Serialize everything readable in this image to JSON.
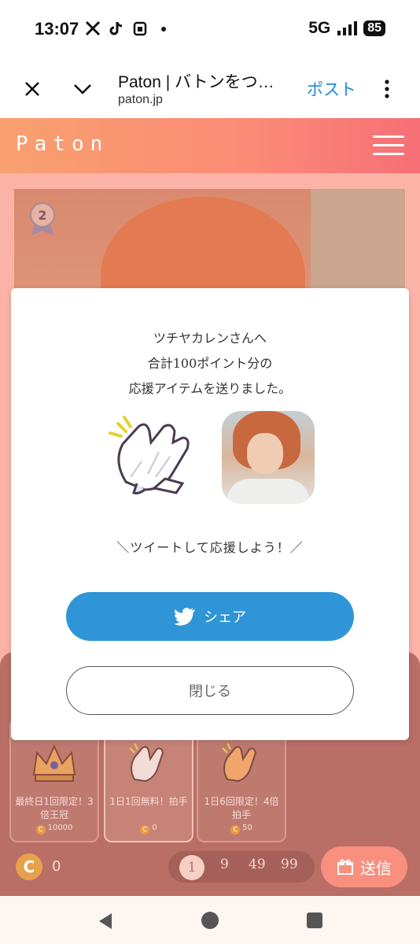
{
  "status_bar": {
    "time": "13:07",
    "network": "5G",
    "battery": "85"
  },
  "browser": {
    "title": "Paton | バトンをつ…",
    "url": "paton.jp",
    "post_label": "ポスト"
  },
  "site": {
    "logo": "Paton"
  },
  "rank": {
    "value": "2"
  },
  "modal": {
    "message_line1": "ツチヤカレンさんへ",
    "message_line2": "合計100ポイント分の",
    "message_line3": "応援アイテムを送りました。",
    "tweet_prompt": "＼ツイートして応援しよう！／",
    "share_label": "シェア",
    "close_label": "閉じる"
  },
  "gifts": [
    {
      "name": "最終日1回限定！3倍王冠",
      "cost": "10000",
      "icon": "crown-icon"
    },
    {
      "name": "1日1回無料！拍手",
      "cost": "0",
      "icon": "clap-icon"
    },
    {
      "name": "1日6回限定！4倍拍手",
      "cost": "50",
      "icon": "clap-icon"
    }
  ],
  "wallet": {
    "coin_symbol": "C",
    "balance": "0"
  },
  "quantity": {
    "options": [
      "1",
      "9",
      "49",
      "99"
    ],
    "selected": "1"
  },
  "send_label": "送信",
  "colors": {
    "header_start": "#f8a06e",
    "header_end": "#f66f76",
    "share": "#2f95d6"
  }
}
